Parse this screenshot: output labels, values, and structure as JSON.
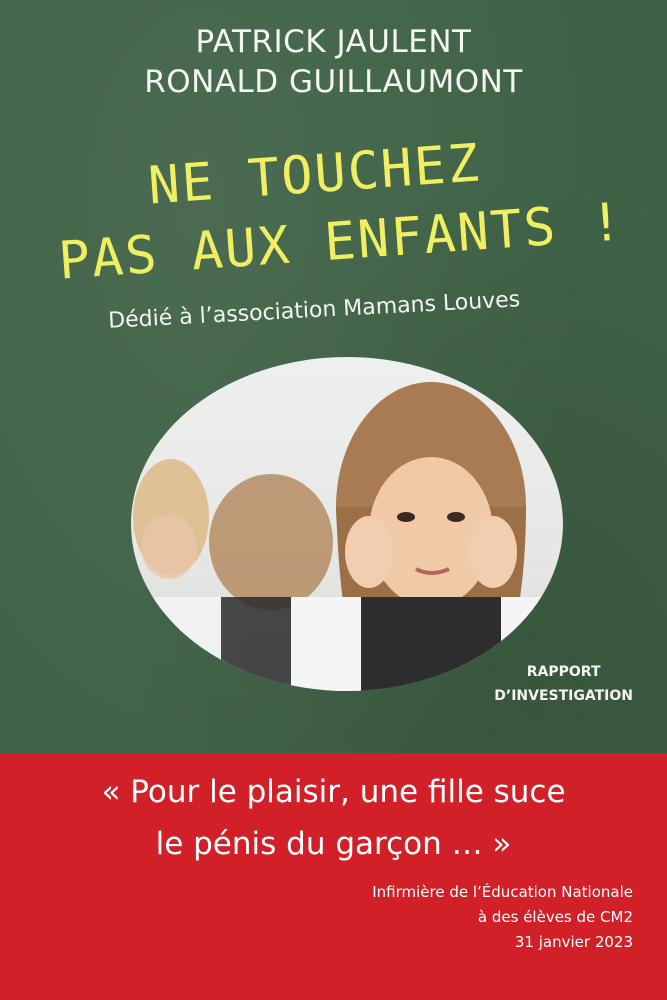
{
  "authors": [
    "PATRICK JAULENT",
    "RONALD GUILLAUMONT"
  ],
  "title": [
    "NE TOUCHEZ",
    "PAS AUX ENFANTS !"
  ],
  "dedication": "Dédié à l’association Mamans Louves",
  "report_label": [
    "RAPPORT",
    "D’INVESTIGATION"
  ],
  "quote": [
    "« Pour le plaisir, une fille suce",
    "le pénis du garçon … »"
  ],
  "source": [
    "Infirmière de l’Éducation Nationale",
    "à des élèves de CM2",
    "31 janvier 2023"
  ],
  "colors": {
    "chalkboard": "#3f6246",
    "chalk_yellow": "#f0ee63",
    "band_red": "#d12027",
    "text_white": "#ffffff"
  }
}
